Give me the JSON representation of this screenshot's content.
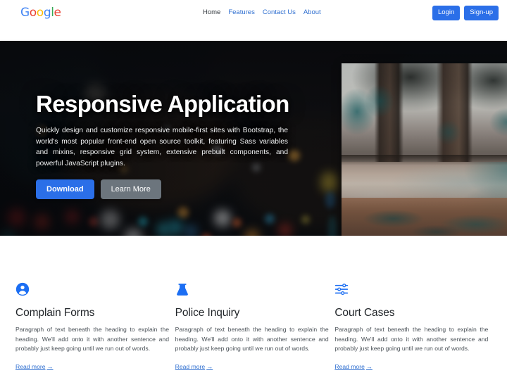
{
  "brand": {
    "logo_text": "Google",
    "logo_letters": [
      {
        "ch": "G",
        "color": "#4285F4"
      },
      {
        "ch": "o",
        "color": "#EA4335"
      },
      {
        "ch": "o",
        "color": "#FBBC05"
      },
      {
        "ch": "g",
        "color": "#4285F4"
      },
      {
        "ch": "l",
        "color": "#34A853"
      },
      {
        "ch": "e",
        "color": "#EA4335"
      }
    ]
  },
  "nav": {
    "items": [
      {
        "label": "Home",
        "active": true
      },
      {
        "label": "Features",
        "active": false
      },
      {
        "label": "Contact Us",
        "active": false
      },
      {
        "label": "About",
        "active": false
      }
    ]
  },
  "auth": {
    "login_label": "Login",
    "signup_label": "Sign-up",
    "button_color": "#2b6fe8"
  },
  "hero": {
    "title": "Responsive Application",
    "subtitle": "Quickly design and customize responsive mobile-first sites with Bootstrap, the world's most popular front-end open source toolkit, featuring Sass variables and mixins, responsive grid system, extensive prebuilt components, and powerful JavaScript plugins.",
    "primary_button": "Download",
    "secondary_button": "Learn More",
    "primary_color": "#2b6fe8",
    "secondary_color": "#6c757d",
    "background_image_alt": "night city bokeh lights",
    "side_image_alt": "forest stream with bare trees"
  },
  "features": {
    "cards": [
      {
        "icon": "person-circle-icon",
        "title": "Complain Forms",
        "text": "Paragraph of text beneath the heading to explain the heading. We'll add onto it with another sentence and probably just keep going until we run out of words.",
        "link_label": "Read more",
        "link_arrow": "→"
      },
      {
        "icon": "flask-icon",
        "title": "Police Inquiry",
        "text": "Paragraph of text beneath the heading to explain the heading. We'll add onto it with another sentence and probably just keep going until we run out of words.",
        "link_label": "Read more",
        "link_arrow": "→"
      },
      {
        "icon": "sliders-icon",
        "title": "Court Cases",
        "text": "Paragraph of text beneath the heading to explain the heading. We'll add onto it with another sentence and probably just keep going until we run out of words.",
        "link_label": "Read more",
        "link_arrow": "→"
      }
    ],
    "icon_color": "#1b6ef3",
    "link_color": "#2f6fd0"
  }
}
